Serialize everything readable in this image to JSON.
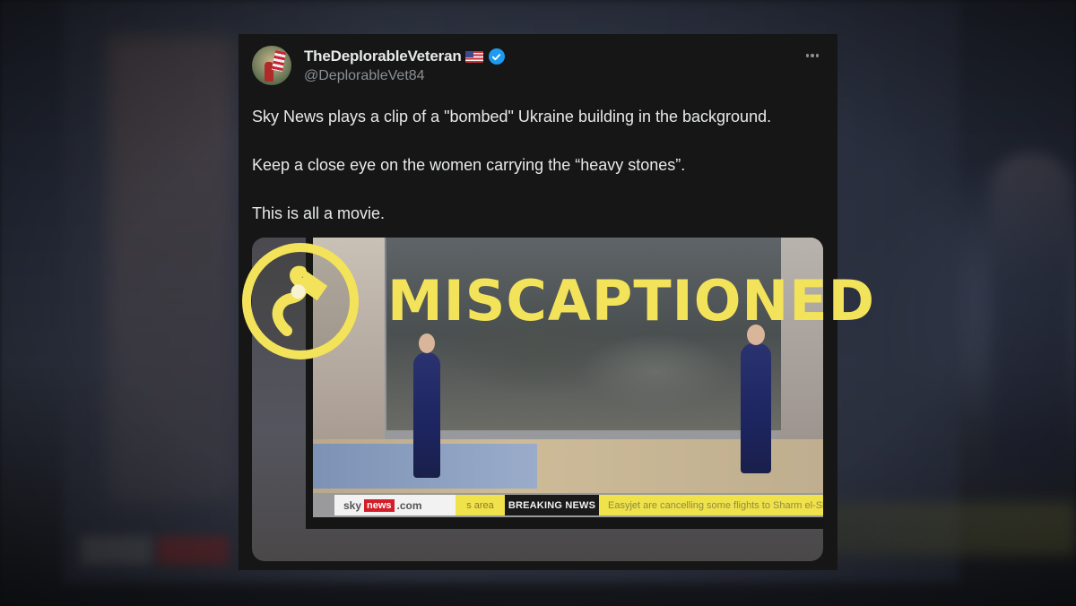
{
  "tweet": {
    "display_name": "TheDeplorableVeteran",
    "flag_icon": "us-flag-icon",
    "verified_icon": "verified-badge-icon",
    "handle": "@DeplorableVet84",
    "more_icon": "more-options-icon",
    "lines": [
      "Sky News plays a clip of a \"bombed\" Ukraine building in the background.",
      "Keep a close eye on the women carrying the “heavy stones”.",
      "This is all a movie."
    ]
  },
  "video": {
    "ticker_sky": "sky",
    "ticker_news": "news",
    "ticker_com": ".com",
    "ticker_area": "s area",
    "ticker_breaking": "BREAKING NEWS",
    "ticker_scroll": "Easyjet are cancelling some flights to Sharm el-Sheikh"
  },
  "stamp": {
    "label": "MISCAPTIONED",
    "logo_icon": "snopes-logo-icon",
    "color": "#f3e35a"
  },
  "colors": {
    "card_bg": "#161616",
    "verified": "#1d9bf0",
    "text": "#e7e9ea",
    "muted": "#8b9096"
  }
}
